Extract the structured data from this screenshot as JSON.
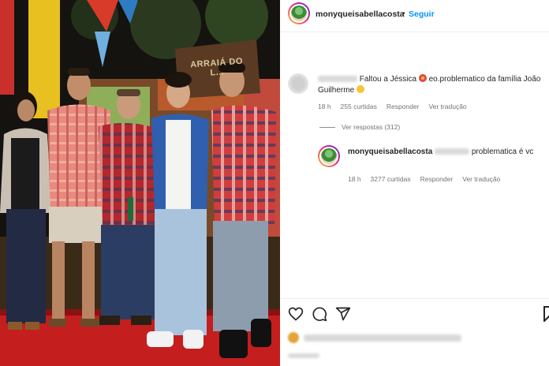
{
  "post": {
    "username": "monyqueisabellacosta",
    "separator": "•",
    "follow_label": "Seguir"
  },
  "photo": {
    "sign_text": "ARRAIÁ DO L..."
  },
  "comments": [
    {
      "text_before_emoji": "Faltou a Jéssica",
      "text_after_emoji": "eo.problematico da família João Guilherme",
      "time": "18 h",
      "likes": "255 curtidas",
      "reply_label": "Responder",
      "translate_label": "Ver tradução",
      "view_replies": "Ver respostas (312)"
    },
    {
      "username": "monyqueisabellacosta",
      "text": "problematica é vc",
      "time": "18 h",
      "likes": "3277 curtidas",
      "reply_label": "Responder",
      "translate_label": "Ver tradução"
    }
  ],
  "icons": [
    "heart-icon",
    "comment-icon",
    "share-icon",
    "save-icon"
  ],
  "colors": {
    "follow": "#0095f6",
    "text": "#262626",
    "muted": "#737373"
  }
}
